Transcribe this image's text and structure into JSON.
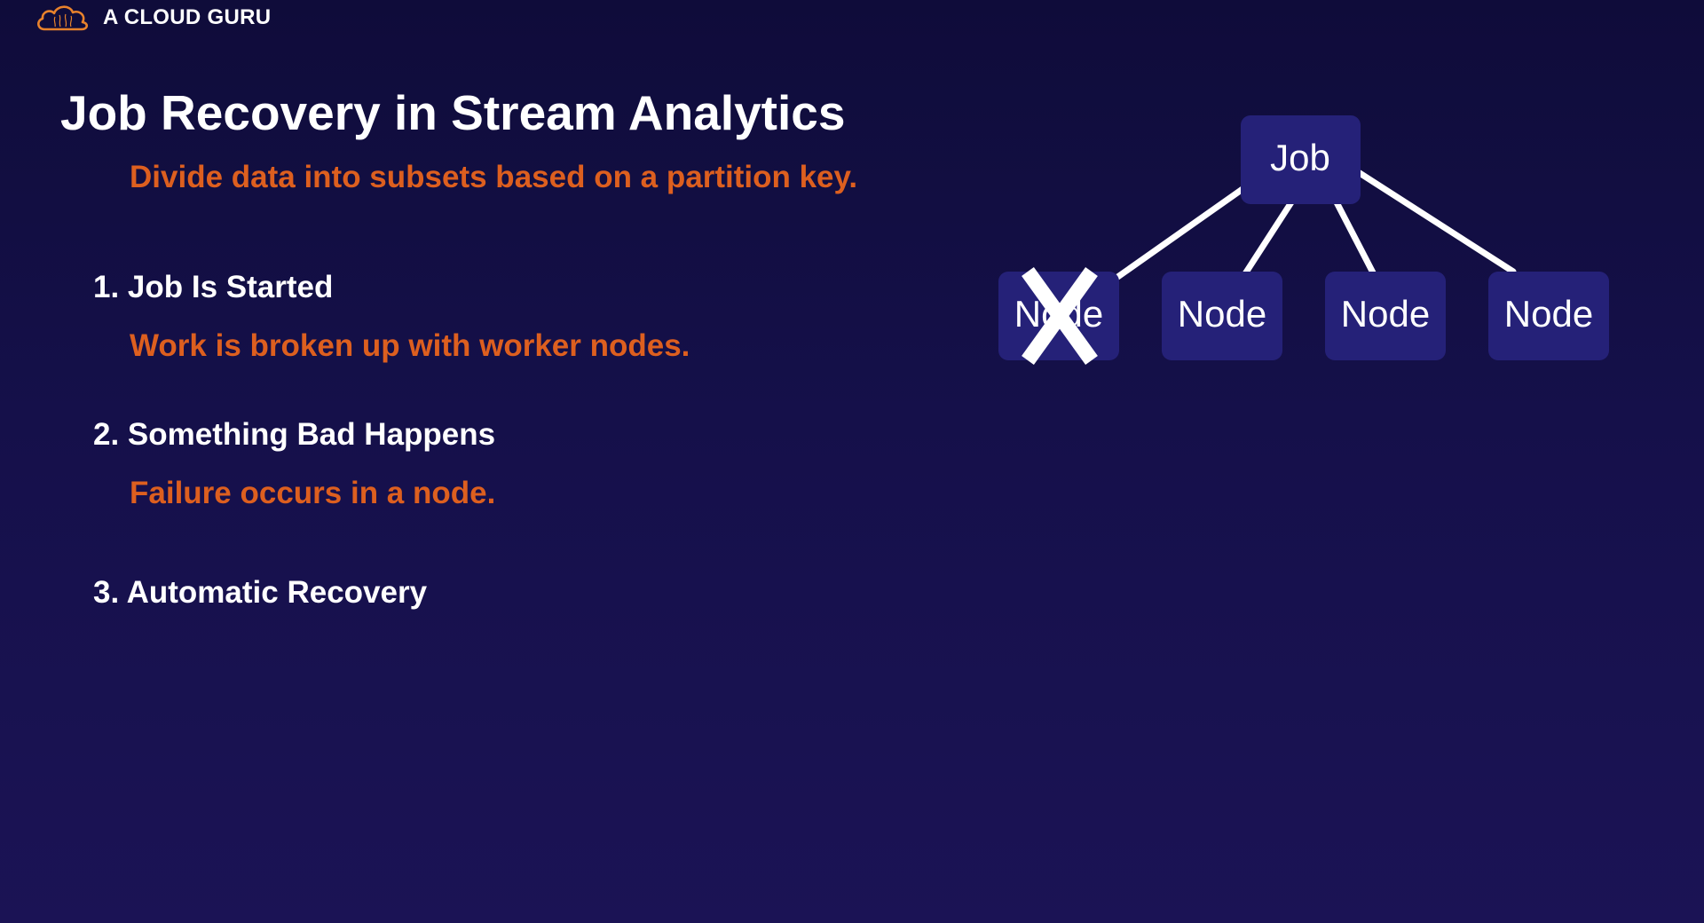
{
  "brand": {
    "name": "A CLOUD GURU",
    "logo_icon": "cloud-logo-icon",
    "accent_color": "#e8822c"
  },
  "slide": {
    "title": "Job Recovery in Stream Analytics",
    "subtitle": "Divide data into subsets based on a partition key.",
    "steps": [
      {
        "heading": "1. Job Is Started",
        "note": "Work is broken up with worker nodes."
      },
      {
        "heading": "2. Something Bad Happens",
        "note": "Failure occurs in a node."
      },
      {
        "heading": "3. Automatic Recovery"
      }
    ]
  },
  "diagram": {
    "root": {
      "label": "Job"
    },
    "nodes": [
      {
        "label": "Node",
        "failed": true
      },
      {
        "label": "Node",
        "failed": false
      },
      {
        "label": "Node",
        "failed": false
      },
      {
        "label": "Node",
        "failed": false
      }
    ],
    "failure_mark_icon": "x-mark-icon"
  },
  "colors": {
    "background": "#130f45",
    "heading": "#ffffff",
    "accent_text": "#dd5f1f",
    "node_fill": "#252178"
  }
}
